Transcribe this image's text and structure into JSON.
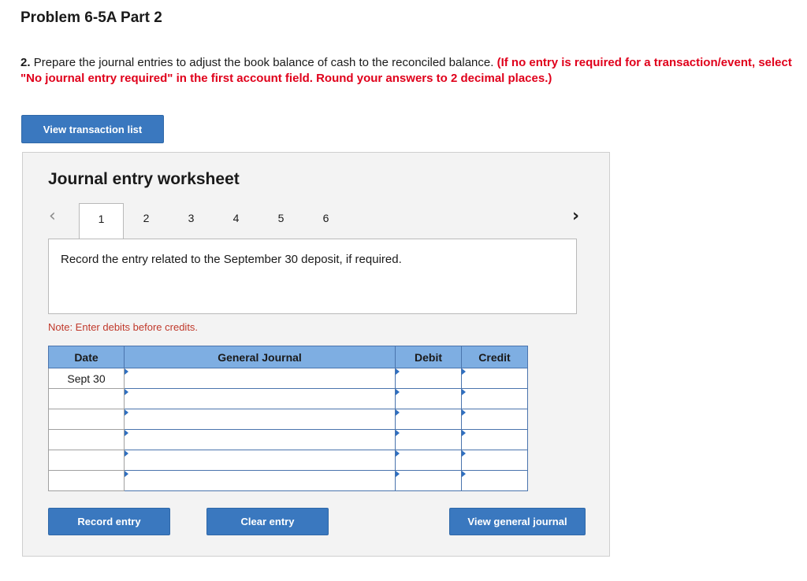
{
  "page": {
    "title": "Problem 6-5A Part 2",
    "instruction_number": "2.",
    "instruction_text": "Prepare the journal entries to adjust the book balance of cash to the reconciled balance.",
    "instruction_note": "(If no entry is required for a transaction/event, select \"No journal entry required\" in the first account field. Round your answers to 2 decimal places.)",
    "view_transaction_list_label": "View transaction list"
  },
  "worksheet": {
    "title": "Journal entry worksheet",
    "prev_icon": "chevron-left-icon",
    "next_icon": "chevron-right-icon",
    "tabs": [
      "1",
      "2",
      "3",
      "4",
      "5",
      "6"
    ],
    "active_tab": "1",
    "prompt": "Record the entry related to the September 30 deposit, if required.",
    "note": "Note: Enter debits before credits.",
    "table": {
      "headers": {
        "date": "Date",
        "general_journal": "General Journal",
        "debit": "Debit",
        "credit": "Credit"
      },
      "rows": [
        {
          "date": "Sept 30",
          "account": "",
          "debit": "",
          "credit": ""
        },
        {
          "date": "",
          "account": "",
          "debit": "",
          "credit": ""
        },
        {
          "date": "",
          "account": "",
          "debit": "",
          "credit": ""
        },
        {
          "date": "",
          "account": "",
          "debit": "",
          "credit": ""
        },
        {
          "date": "",
          "account": "",
          "debit": "",
          "credit": ""
        },
        {
          "date": "",
          "account": "",
          "debit": "",
          "credit": ""
        }
      ]
    },
    "buttons": {
      "record_entry": "Record entry",
      "clear_entry": "Clear entry",
      "view_general_journal": "View general journal"
    }
  },
  "colors": {
    "button_blue": "#3a78bf",
    "header_blue": "#7eaee2",
    "instruction_red": "#e0001b",
    "note_red": "#c0392b"
  }
}
